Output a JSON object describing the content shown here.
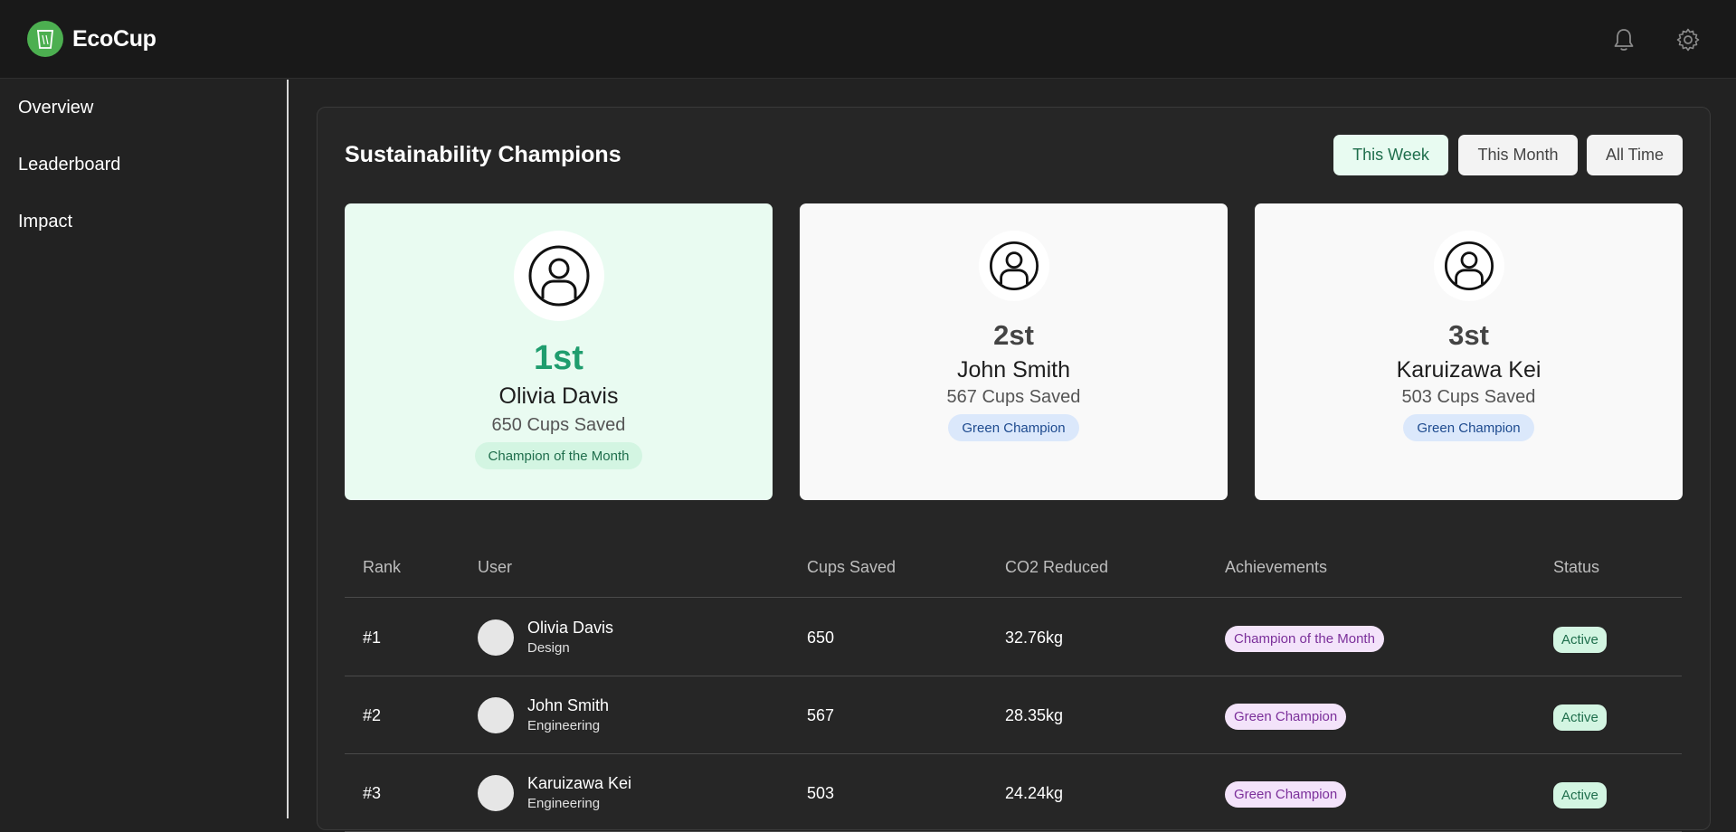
{
  "app": {
    "name": "EcoCup"
  },
  "header": {
    "icons": [
      "bell-icon",
      "gear-icon"
    ]
  },
  "sidebar": {
    "items": [
      {
        "label": "Overview"
      },
      {
        "label": "Leaderboard"
      },
      {
        "label": "Impact"
      }
    ]
  },
  "leaderboard": {
    "title": "Sustainability Champions",
    "filters": [
      {
        "label": "This Week",
        "active": true
      },
      {
        "label": "This Month",
        "active": false
      },
      {
        "label": "All Time",
        "active": false
      }
    ],
    "champions": [
      {
        "rank": "1st",
        "name": "Olivia Davis",
        "cups": "650 Cups Saved",
        "badge": "Champion of the Month"
      },
      {
        "rank": "2st",
        "name": "John Smith",
        "cups": "567 Cups Saved",
        "badge": "Green Champion"
      },
      {
        "rank": "3st",
        "name": "Karuizawa Kei",
        "cups": "503 Cups Saved",
        "badge": "Green Champion"
      }
    ],
    "table": {
      "headers": [
        "Rank",
        "User",
        "Cups Saved",
        "CO2 Reduced",
        "Achievements",
        "Status"
      ],
      "rows": [
        {
          "rank": "#1",
          "name": "Olivia Davis",
          "dept": "Design",
          "cups": "650",
          "co2": "32.76kg",
          "achievement": "Champion of the Month",
          "status": "Active"
        },
        {
          "rank": "#2",
          "name": "John Smith",
          "dept": "Engineering",
          "cups": "567",
          "co2": "28.35kg",
          "achievement": "Green Champion",
          "status": "Active"
        },
        {
          "rank": "#3",
          "name": "Karuizawa Kei",
          "dept": "Engineering",
          "cups": "503",
          "co2": "24.24kg",
          "achievement": "Green Champion",
          "status": "Active"
        }
      ]
    }
  },
  "colors": {
    "brand": "#4caf50",
    "accent_green": "#1f9d6e",
    "background": "#222222"
  }
}
